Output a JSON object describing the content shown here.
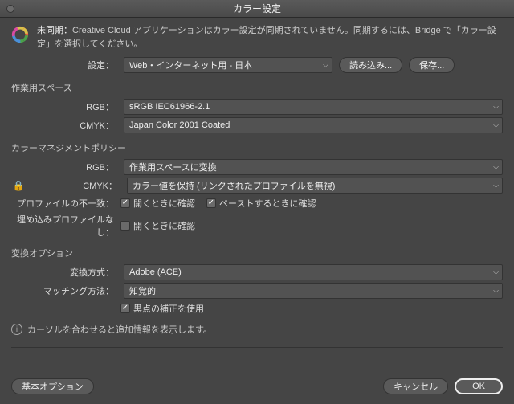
{
  "title": "カラー設定",
  "warning": {
    "label": "未同期：",
    "text": "Creative Cloud アプリケーションはカラー設定が同期されていません。同期するには、Bridge で「カラー設定」を選択してください。"
  },
  "settings_row": {
    "label": "設定：",
    "preset": "Web・インターネット用 - 日本",
    "load": "読み込み...",
    "save": "保存..."
  },
  "section_workspace": {
    "title": "作業用スペース",
    "rgb_label": "RGB：",
    "rgb_value": "sRGB IEC61966-2.1",
    "cmyk_label": "CMYK：",
    "cmyk_value": "Japan Color 2001 Coated"
  },
  "section_policy": {
    "title": "カラーマネジメントポリシー",
    "rgb_label": "RGB：",
    "rgb_value": "作業用スペースに変換",
    "cmyk_label": "CMYK：",
    "cmyk_value": "カラー値を保持 (リンクされたプロファイルを無視)",
    "mismatch_label": "プロファイルの不一致：",
    "mismatch_open": "開くときに確認",
    "mismatch_paste": "ペーストするときに確認",
    "missing_label": "埋め込みプロファイルなし：",
    "missing_open": "開くときに確認"
  },
  "section_convert": {
    "title": "変換オプション",
    "engine_label": "変換方式：",
    "engine_value": "Adobe (ACE)",
    "intent_label": "マッチング方法：",
    "intent_value": "知覚的",
    "blackpoint": "黒点の補正を使用"
  },
  "info_hint": "カーソルを合わせると追加情報を表示します。",
  "footer": {
    "basic": "基本オプション",
    "cancel": "キャンセル",
    "ok": "OK"
  },
  "checkbox_states": {
    "mismatch_open": true,
    "mismatch_paste": true,
    "missing_open": false,
    "blackpoint": true
  }
}
